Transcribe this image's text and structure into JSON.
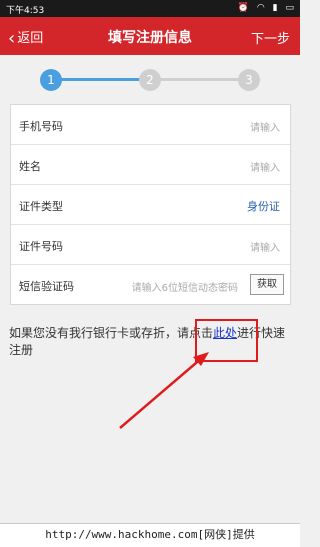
{
  "status_bar": {
    "time": "下午4:53",
    "icons": [
      "alarm-icon",
      "wifi-icon",
      "signal-icon",
      "battery-icon"
    ]
  },
  "nav": {
    "back_label": "返回",
    "title": "填写注册信息",
    "next_label": "下一步"
  },
  "stepper": {
    "steps": [
      "1",
      "2",
      "3"
    ],
    "active_step": 1,
    "active_color": "#4a9fe0",
    "inactive_color": "#cfcfcf"
  },
  "form": {
    "fields": [
      {
        "label": "手机号码",
        "placeholder": "请输入"
      },
      {
        "label": "姓名",
        "placeholder": "请输入"
      },
      {
        "label": "证件类型",
        "value": "身份证"
      },
      {
        "label": "证件号码",
        "placeholder": "请输入"
      },
      {
        "label": "短信验证码",
        "placeholder": "请输入6位短信动态密码",
        "button": "获取"
      }
    ]
  },
  "note": {
    "before": "如果您没有我行银行卡或存折，请点击",
    "link": "此处",
    "after": "进行快速注册"
  },
  "footer": {
    "text": "http://www.hackhome.com[网侠]提供"
  },
  "colors": {
    "brand_red": "#d3262b",
    "annotation_red": "#e01b1b"
  }
}
